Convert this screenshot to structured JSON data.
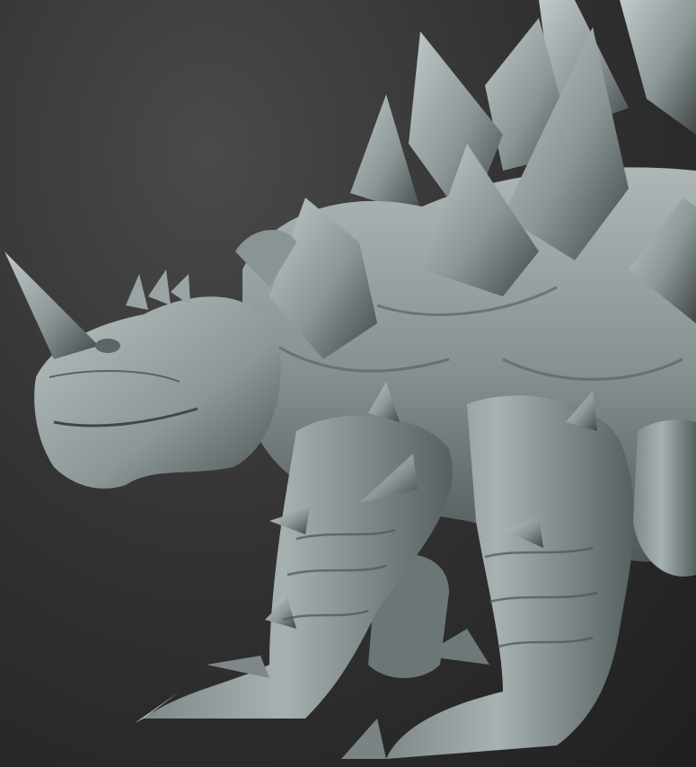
{
  "scene": {
    "subject_icon": "sculpted-creature-render",
    "colors": {
      "background_light": "#4a4a4a",
      "background_dark": "#1f1f1f",
      "clay_light": "#b3bcbc",
      "clay_mid": "#8a9494",
      "clay_dark": "#4e5656",
      "clay_shadow": "#2f3535"
    }
  }
}
